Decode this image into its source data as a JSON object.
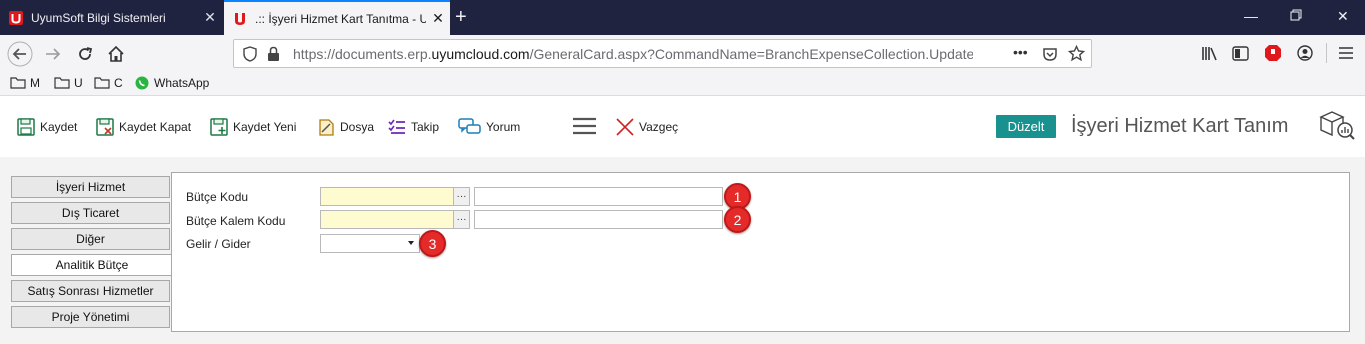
{
  "browser": {
    "tabs": [
      {
        "title": "UyumSoft Bilgi Sistemleri",
        "active": false
      },
      {
        "title": ".:: İşyeri Hizmet Kart Tanıtma - U",
        "active": true
      }
    ],
    "url_prefix": "https://documents.erp.",
    "url_domain": "uyumcloud.com",
    "url_suffix": "/GeneralCard.aspx?CommandName=BranchExpenseCollection.Update&C",
    "bookmarks": [
      "M",
      "U",
      "C",
      "WhatsApp"
    ]
  },
  "toolbar": {
    "buttons": [
      {
        "label": "Kaydet",
        "icon": "save-icon"
      },
      {
        "label": "Kaydet Kapat",
        "icon": "save-close-icon"
      },
      {
        "label": "Kaydet Yeni",
        "icon": "save-new-icon"
      },
      {
        "label": "Dosya",
        "icon": "file-icon"
      },
      {
        "label": "Takip",
        "icon": "checklist-icon"
      },
      {
        "label": "Yorum",
        "icon": "comment-icon"
      },
      {
        "label": "Vazgeç",
        "icon": "cancel-x-icon"
      }
    ],
    "edit_label": "Düzelt",
    "page_title": "İşyeri Hizmet Kart Tanım"
  },
  "sidebar": {
    "tabs": [
      {
        "label": "İşyeri Hizmet",
        "active": false
      },
      {
        "label": "Dış Ticaret",
        "active": false
      },
      {
        "label": "Diğer",
        "active": false
      },
      {
        "label": "Analitik Bütçe",
        "active": true
      },
      {
        "label": "Satış Sonrası Hizmetler",
        "active": false
      },
      {
        "label": "Proje Yönetimi",
        "active": false
      }
    ]
  },
  "form": {
    "budget_code_label": "Bütçe Kodu",
    "budget_item_code_label": "Bütçe Kalem Kodu",
    "income_expense_label": "Gelir / Gider",
    "budget_code_value": "",
    "budget_item_code_value": "",
    "income_expense_value": "",
    "ellipsis": "···"
  },
  "badges": [
    "1",
    "2",
    "3"
  ],
  "colors": {
    "tabbar": "#202340",
    "accent_teal": "#18918f",
    "badge_red": "#e52a2a",
    "code_field_bg": "#fefbd0"
  }
}
